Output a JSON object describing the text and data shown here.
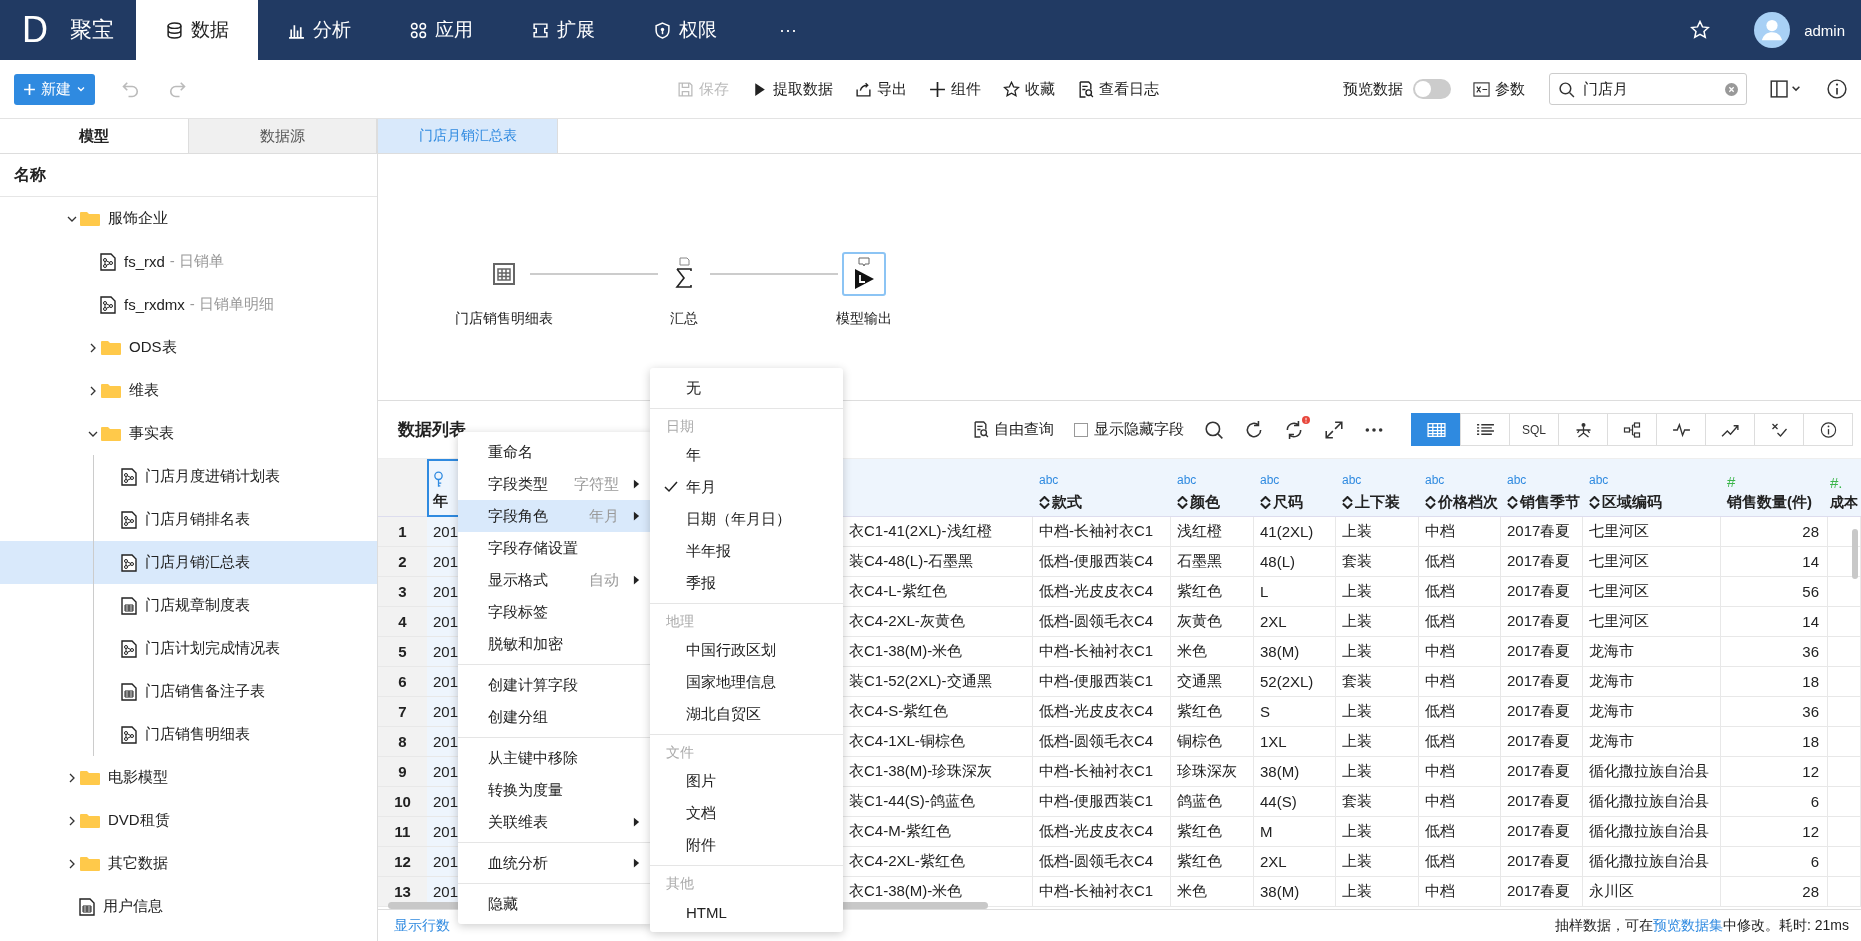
{
  "nav": {
    "logo": "D",
    "brand": "聚宝",
    "tabs": [
      {
        "label": "数据",
        "selected": true
      },
      {
        "label": "分析",
        "selected": false
      },
      {
        "label": "应用",
        "selected": false
      },
      {
        "label": "扩展",
        "selected": false
      },
      {
        "label": "权限",
        "selected": false
      }
    ],
    "more": "···",
    "user": "admin"
  },
  "toolbar": {
    "new_button": "新建",
    "actions": [
      {
        "label": "保存",
        "disabled": true
      },
      {
        "label": "提取数据",
        "disabled": false
      },
      {
        "label": "导出",
        "disabled": false
      },
      {
        "label": "组件",
        "disabled": false
      },
      {
        "label": "收藏",
        "disabled": false
      },
      {
        "label": "查看日志",
        "disabled": false
      }
    ],
    "preview": {
      "label": "预览数据",
      "on": false
    },
    "params": "参数",
    "search": {
      "value": "门店月"
    }
  },
  "left_tabs": [
    {
      "label": "模型",
      "selected": true
    },
    {
      "label": "数据源",
      "selected": false
    }
  ],
  "tree": {
    "header": "名称",
    "items": [
      {
        "label": "服饰企业",
        "kind": "folder",
        "expanded": true,
        "selected": false,
        "children": [
          {
            "label": "fs_rxd",
            "description": "- 日销单",
            "kind": "model",
            "selected": false
          },
          {
            "label": "fs_rxdmx",
            "description": "- 日销单明细",
            "kind": "model",
            "selected": false
          },
          {
            "label": "ODS表",
            "kind": "folder",
            "expanded": false,
            "selected": false
          },
          {
            "label": "维表",
            "kind": "folder",
            "expanded": false,
            "selected": false
          },
          {
            "label": "事实表",
            "kind": "folder",
            "expanded": true,
            "selected": false,
            "children": [
              {
                "label": "门店月度进销计划表",
                "kind": "model",
                "selected": false
              },
              {
                "label": "门店月销排名表",
                "kind": "model",
                "selected": false
              },
              {
                "label": "门店月销汇总表",
                "kind": "model",
                "selected": true
              },
              {
                "label": "门店规章制度表",
                "kind": "table",
                "selected": false
              },
              {
                "label": "门店计划完成情况表",
                "kind": "model",
                "selected": false
              },
              {
                "label": "门店销售备注子表",
                "kind": "table",
                "selected": false
              },
              {
                "label": "门店销售明细表",
                "kind": "model",
                "selected": false
              }
            ]
          }
        ]
      },
      {
        "label": "电影模型",
        "kind": "folder",
        "expanded": false,
        "selected": false
      },
      {
        "label": "DVD租赁",
        "kind": "folder",
        "expanded": false,
        "selected": false
      },
      {
        "label": "其它数据",
        "kind": "folder",
        "expanded": false,
        "selected": false
      },
      {
        "label": "用户信息",
        "kind": "table",
        "selected": false
      }
    ]
  },
  "doc_tabs": [
    {
      "label": "门店月销汇总表",
      "selected": true
    }
  ],
  "flow": {
    "nodes": [
      {
        "label": "门店销售明细表",
        "kind": "table",
        "selected": false
      },
      {
        "label": "汇总",
        "kind": "sum",
        "selected": false
      },
      {
        "label": "模型输出",
        "kind": "output",
        "selected": true
      }
    ]
  },
  "data_list": {
    "title": "数据列表",
    "free_query": "自由查询",
    "show_hidden": {
      "label": "显示隐藏字段",
      "checked": false
    },
    "view_buttons": [
      {
        "selected": true
      },
      {
        "selected": false
      },
      {
        "label": "SQL",
        "selected": false
      },
      {
        "selected": false
      },
      {
        "selected": false
      },
      {
        "selected": false
      },
      {
        "selected": false
      },
      {
        "selected": false
      },
      {
        "selected": false
      }
    ]
  },
  "table": {
    "columns": [
      {
        "kind": "key",
        "name": "年"
      },
      {
        "kind": "cut"
      },
      {
        "kind": "text",
        "type_label": "abc",
        "name": "款式"
      },
      {
        "kind": "text",
        "type_label": "abc",
        "name": "颜色"
      },
      {
        "kind": "text",
        "type_label": "abc",
        "name": "尺码"
      },
      {
        "kind": "text",
        "type_label": "abc",
        "name": "上下装"
      },
      {
        "kind": "text",
        "type_label": "abc",
        "name": "价格档次"
      },
      {
        "kind": "text",
        "type_label": "abc",
        "name": "销售季节"
      },
      {
        "kind": "text",
        "type_label": "abc",
        "name": "区域编码"
      },
      {
        "kind": "number",
        "type_label": "#",
        "name": "销售数量(件)"
      },
      {
        "kind": "number",
        "type_label": "#.",
        "name": "成本"
      }
    ],
    "rows": [
      {
        "num": "1",
        "cells": [
          "201",
          "衣C1-41(2XL)-浅红橙",
          "中档-长袖衬衣C1",
          "浅红橙",
          "41(2XL)",
          "上装",
          "中档",
          "2017春夏",
          "七里河区",
          "28"
        ]
      },
      {
        "num": "2",
        "cells": [
          "201",
          "装C4-48(L)-石墨黑",
          "低档-便服西装C4",
          "石墨黑",
          "48(L)",
          "套装",
          "低档",
          "2017春夏",
          "七里河区",
          "14"
        ]
      },
      {
        "num": "3",
        "cells": [
          "201",
          "衣C4-L-紫红色",
          "低档-光皮皮衣C4",
          "紫红色",
          "L",
          "上装",
          "低档",
          "2017春夏",
          "七里河区",
          "56"
        ]
      },
      {
        "num": "4",
        "cells": [
          "201",
          "衣C4-2XL-灰黄色",
          "低档-圆领毛衣C4",
          "灰黄色",
          "2XL",
          "上装",
          "低档",
          "2017春夏",
          "七里河区",
          "14"
        ]
      },
      {
        "num": "5",
        "cells": [
          "201",
          "衣C1-38(M)-米色",
          "中档-长袖衬衣C1",
          "米色",
          "38(M)",
          "上装",
          "中档",
          "2017春夏",
          "龙海市",
          "36"
        ]
      },
      {
        "num": "6",
        "cells": [
          "201",
          "装C1-52(2XL)-交通黑",
          "中档-便服西装C1",
          "交通黑",
          "52(2XL)",
          "套装",
          "中档",
          "2017春夏",
          "龙海市",
          "18"
        ]
      },
      {
        "num": "7",
        "cells": [
          "201",
          "衣C4-S-紫红色",
          "低档-光皮皮衣C4",
          "紫红色",
          "S",
          "上装",
          "低档",
          "2017春夏",
          "龙海市",
          "36"
        ]
      },
      {
        "num": "8",
        "cells": [
          "201",
          "衣C4-1XL-铜棕色",
          "低档-圆领毛衣C4",
          "铜棕色",
          "1XL",
          "上装",
          "低档",
          "2017春夏",
          "龙海市",
          "18"
        ]
      },
      {
        "num": "9",
        "cells": [
          "201",
          "衣C1-38(M)-珍珠深灰",
          "中档-长袖衬衣C1",
          "珍珠深灰",
          "38(M)",
          "上装",
          "中档",
          "2017春夏",
          "循化撒拉族自治县",
          "12"
        ]
      },
      {
        "num": "10",
        "cells": [
          "201",
          "装C1-44(S)-鸽蓝色",
          "中档-便服西装C1",
          "鸽蓝色",
          "44(S)",
          "套装",
          "中档",
          "2017春夏",
          "循化撒拉族自治县",
          "6"
        ]
      },
      {
        "num": "11",
        "cells": [
          "201",
          "衣C4-M-紫红色",
          "低档-光皮皮衣C4",
          "紫红色",
          "M",
          "上装",
          "低档",
          "2017春夏",
          "循化撒拉族自治县",
          "12"
        ]
      },
      {
        "num": "12",
        "cells": [
          "201",
          "衣C4-2XL-紫红色",
          "低档-圆领毛衣C4",
          "紫红色",
          "2XL",
          "上装",
          "低档",
          "2017春夏",
          "循化撒拉族自治县",
          "6"
        ]
      },
      {
        "num": "13",
        "cells": [
          "201",
          "衣C1-38(M)-米色",
          "中档-长袖衬衣C1",
          "米色",
          "38(M)",
          "上装",
          "中档",
          "2017春夏",
          "永川区",
          "28"
        ]
      }
    ]
  },
  "footer": {
    "show_rows": "显示行数",
    "status_before": "抽样数据，可在",
    "status_link": "预览数据集",
    "status_after": "中修改。耗时: 21ms"
  },
  "context_menu": {
    "groups": [
      [
        {
          "label": "重命名",
          "submenu": false,
          "selected": false
        },
        {
          "label": "字段类型",
          "hint": "字符型",
          "submenu": true,
          "selected": false
        },
        {
          "label": "字段角色",
          "hint": "年月",
          "submenu": true,
          "selected": true
        },
        {
          "label": "字段存储设置",
          "submenu": false,
          "selected": false
        },
        {
          "label": "显示格式",
          "hint": "自动",
          "submenu": true,
          "selected": false
        },
        {
          "label": "字段标签",
          "submenu": false,
          "selected": false
        },
        {
          "label": "脱敏和加密",
          "submenu": false,
          "selected": false
        }
      ],
      [
        {
          "label": "创建计算字段",
          "submenu": false,
          "selected": false
        },
        {
          "label": "创建分组",
          "submenu": false,
          "selected": false
        }
      ],
      [
        {
          "label": "从主键中移除",
          "submenu": false,
          "selected": false
        },
        {
          "label": "转换为度量",
          "submenu": false,
          "selected": false
        },
        {
          "label": "关联维表",
          "submenu": true,
          "selected": false
        }
      ],
      [
        {
          "label": "血统分析",
          "submenu": true,
          "selected": false
        }
      ],
      [
        {
          "label": "隐藏",
          "submenu": false,
          "selected": false
        }
      ]
    ]
  },
  "submenu": {
    "groups": [
      {
        "items": [
          {
            "label": "无",
            "checked": false
          }
        ]
      },
      {
        "header": "日期",
        "items": [
          {
            "label": "年",
            "checked": false
          },
          {
            "label": "年月",
            "checked": true
          },
          {
            "label": "日期（年月日）",
            "checked": false
          },
          {
            "label": "半年报",
            "checked": false
          },
          {
            "label": "季报",
            "checked": false
          }
        ]
      },
      {
        "header": "地理",
        "items": [
          {
            "label": "中国行政区划",
            "checked": false
          },
          {
            "label": "国家地理信息",
            "checked": false
          },
          {
            "label": "湖北自贸区",
            "checked": false
          }
        ]
      },
      {
        "header": "文件",
        "items": [
          {
            "label": "图片",
            "checked": false
          },
          {
            "label": "文档",
            "checked": false
          },
          {
            "label": "附件",
            "checked": false
          }
        ]
      },
      {
        "header": "其他",
        "items": [
          {
            "label": "HTML",
            "checked": false
          }
        ]
      }
    ]
  }
}
